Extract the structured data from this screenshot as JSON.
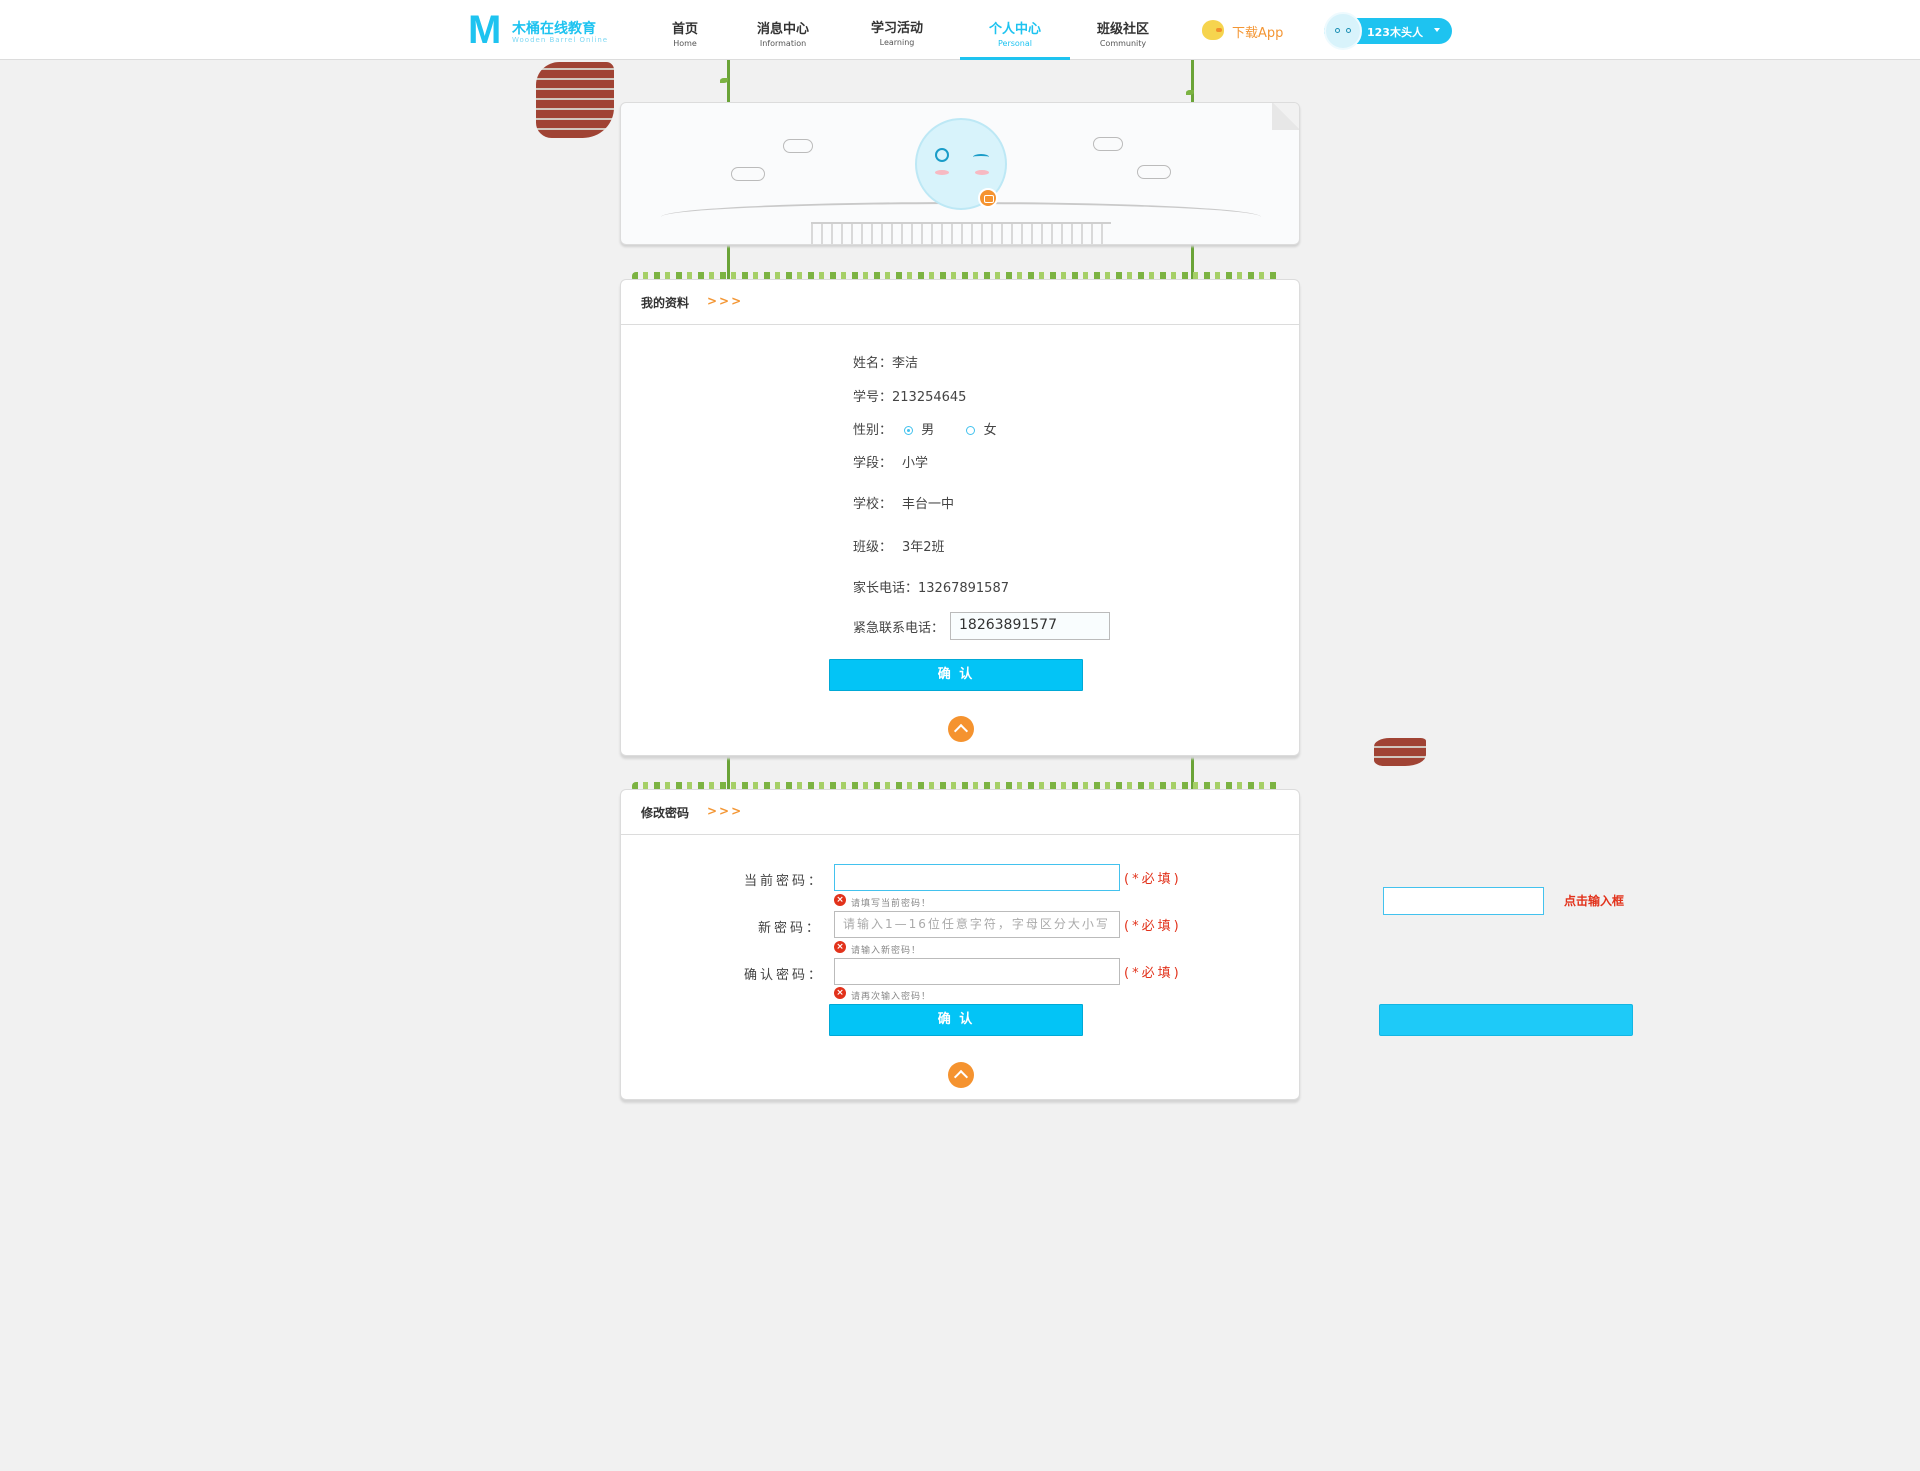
{
  "header": {
    "logo_mark": "M",
    "logo_cn": "木桶在线教育",
    "logo_en": "Wooden Barrel Online",
    "nav": [
      {
        "cn": "首页",
        "en": "Home"
      },
      {
        "cn": "消息中心",
        "en": "Information"
      },
      {
        "cn": "学习活动",
        "en": "Learning"
      },
      {
        "cn": "个人中心",
        "en": "Personal"
      },
      {
        "cn": "班级社区",
        "en": "Community"
      }
    ],
    "active_index": 3,
    "download_label": "下载App",
    "username": "123木头人"
  },
  "profile": {
    "title": "我的资料",
    "arrows": ">>>",
    "name_label": "姓名：",
    "name": "李洁",
    "id_label": "学号：",
    "id": "213254645",
    "gender_label": "性别：",
    "gender_options": [
      "男",
      "女"
    ],
    "gender_selected": "男",
    "stage_label": "学段：",
    "stage": "小学",
    "school_label": "学校：",
    "school": "丰台一中",
    "class_label": "班级：",
    "class": "3年2班",
    "parent_phone_label": "家长电话：",
    "parent_phone": "13267891587",
    "emergency_label": "紧急联系电话：",
    "emergency_phone": "18263891577",
    "confirm_label": "确 认"
  },
  "password": {
    "title": "修改密码",
    "arrows": ">>>",
    "current_label": "当前密码：",
    "current_value": "",
    "current_error": "请填写当前密码！",
    "new_label": "新密码：",
    "new_placeholder": "请输入1—16位任意字符，字母区分大小写",
    "new_error": "请输入新密码！",
    "confirm_pw_label": "确认密码：",
    "confirm_pw_value": "",
    "confirm_pw_error": "请再次输入密码！",
    "required": "(*必填)",
    "confirm_label": "确 认"
  },
  "demo": {
    "input_label": "点击输入框"
  },
  "colors": {
    "accent": "#03c4f6",
    "orange": "#f5932f",
    "error": "#e2321b"
  }
}
